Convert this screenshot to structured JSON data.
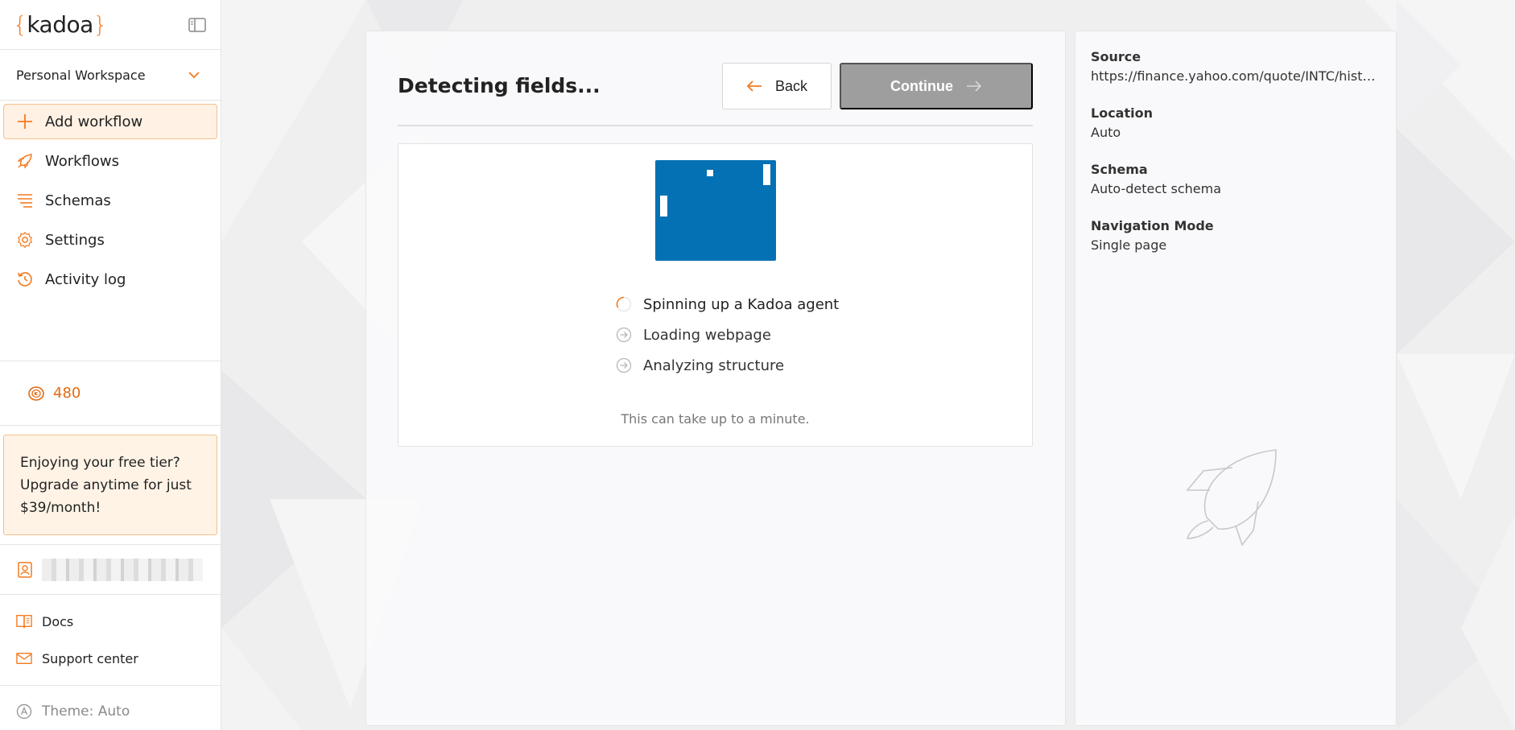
{
  "logo": {
    "open": "{",
    "name": "kadoa",
    "close": "}"
  },
  "sidebar": {
    "workspace": "Personal Workspace",
    "nav": [
      {
        "label": "Add workflow",
        "icon": "plus-icon"
      },
      {
        "label": "Workflows",
        "icon": "rocket-icon"
      },
      {
        "label": "Schemas",
        "icon": "schema-icon"
      },
      {
        "label": "Settings",
        "icon": "gear-icon"
      },
      {
        "label": "Activity log",
        "icon": "history-icon"
      }
    ],
    "credits": "480",
    "upgrade": {
      "line1": "Enjoying your free tier?",
      "line2": "Upgrade anytime for just",
      "line3": "$39/month!"
    },
    "links": [
      {
        "label": "Docs",
        "icon": "book-icon"
      },
      {
        "label": "Support center",
        "icon": "mail-icon"
      }
    ],
    "theme": "Theme: Auto"
  },
  "main": {
    "title": "Detecting fields...",
    "back_label": "Back",
    "continue_label": "Continue",
    "steps": [
      {
        "label": "Spinning up a Kadoa agent",
        "state": "in-progress"
      },
      {
        "label": "Loading webpage",
        "state": "pending"
      },
      {
        "label": "Analyzing structure",
        "state": "pending"
      }
    ],
    "note": "This can take up to a minute."
  },
  "details": {
    "source_label": "Source",
    "source_value": "https://finance.yahoo.com/quote/INTC/history/",
    "location_label": "Location",
    "location_value": "Auto",
    "schema_label": "Schema",
    "schema_value": "Auto-detect schema",
    "navigation_label": "Navigation Mode",
    "navigation_value": "Single page"
  },
  "colors": {
    "accent": "#f47a1f",
    "game_blue": "#0471b4",
    "continue_disabled": "#9e9e9e"
  }
}
